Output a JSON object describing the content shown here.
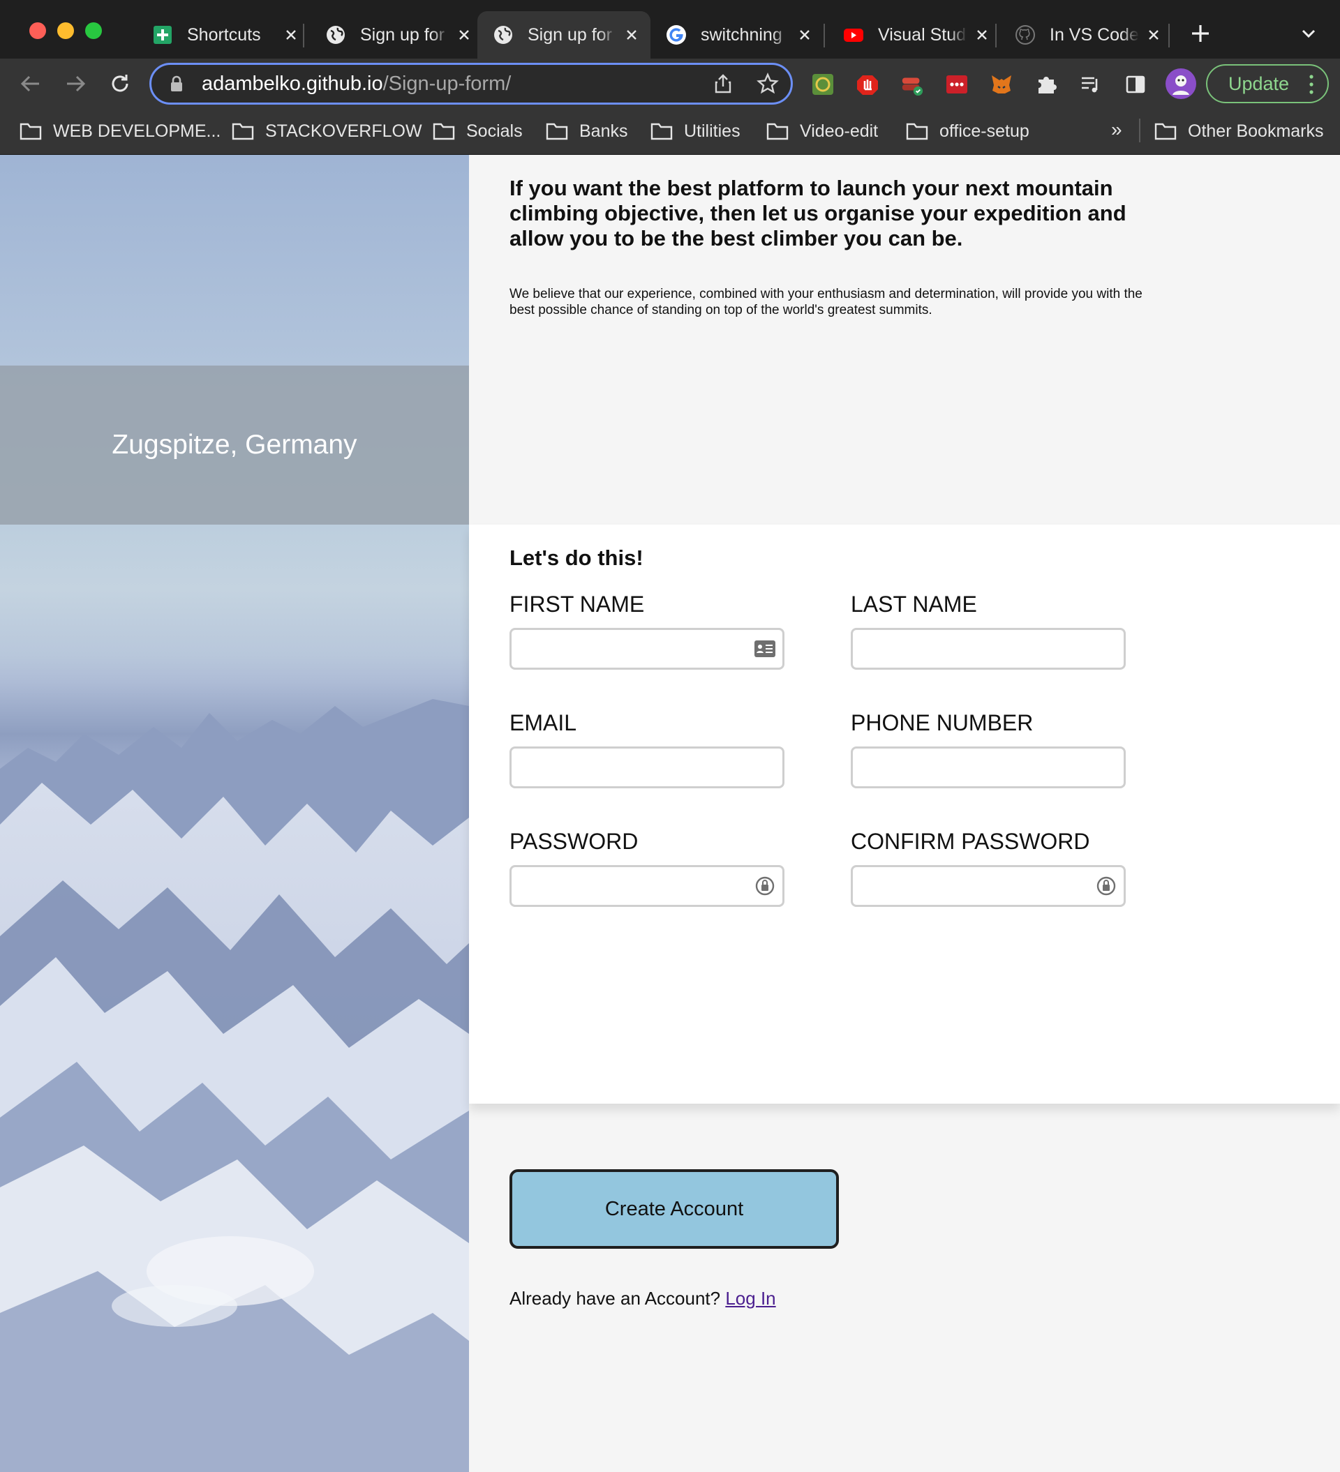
{
  "browser": {
    "tabs": [
      {
        "label": "Shortcuts",
        "icon": "sheets-icon"
      },
      {
        "label": "Sign up for",
        "icon": "globe-icon"
      },
      {
        "label": "Sign up for",
        "icon": "globe-icon",
        "active": true
      },
      {
        "label": "switchning",
        "icon": "google-icon"
      },
      {
        "label": "Visual Stud",
        "icon": "youtube-icon"
      },
      {
        "label": "In VS Code",
        "icon": "github-icon"
      }
    ],
    "url_host": "adambelko.github.io",
    "url_path": "/Sign-up-form/",
    "update_label": "Update",
    "bookmarks": [
      "WEB DEVELOPME...",
      "STACKOVERFLOW",
      "Socials",
      "Banks",
      "Utilities",
      "Video-edit",
      "office-setup"
    ],
    "bookmarks_overflow": "»",
    "other_bookmarks": "Other Bookmarks"
  },
  "hero": {
    "caption": "Zugspitze, Germany"
  },
  "intro": {
    "heading": "If you want the best platform to launch your next mountain climbing objective, then let us organise your expedition and allow you to be the best climber you can be.",
    "text": "We believe that our experience, combined with your enthusiasm and determination, will provide you with the best possible chance of standing on top of the world's greatest summits."
  },
  "form": {
    "title": "Let's do this!",
    "first_name_label": "FIRST NAME",
    "last_name_label": "LAST NAME",
    "email_label": "EMAIL",
    "phone_label": "PHONE NUMBER",
    "password_label": "PASSWORD",
    "confirm_password_label": "CONFIRM PASSWORD",
    "first_name_value": "",
    "last_name_value": "",
    "email_value": "",
    "phone_value": "",
    "password_value": "",
    "confirm_password_value": ""
  },
  "actions": {
    "create_label": "Create Account",
    "login_prompt": "Already have an Account?",
    "login_link": "Log In"
  },
  "colors": {
    "button_bg": "#93c6de",
    "link": "#4b1f8f",
    "omnibox_focus": "#6c8ff6"
  }
}
